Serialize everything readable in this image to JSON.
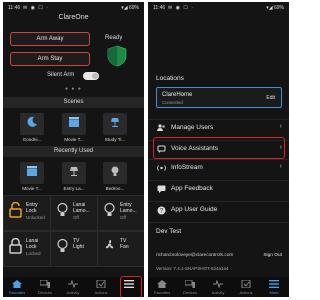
{
  "left": {
    "status": {
      "time": "11:46",
      "battery": "69%"
    },
    "title": "ClareOne",
    "arm_away": "Arm Away",
    "arm_stay": "Arm Stay",
    "ready": "Ready",
    "silent_arm": "Silent Arm",
    "scenes_header": "Scenes",
    "scenes": [
      "Goodni...",
      "Movie T...",
      "Study Ti..."
    ],
    "recent_header": "Recently Used",
    "recent": [
      "Movie T...",
      "Entry La...",
      "Bedroo..."
    ],
    "devices": [
      {
        "name1": "Entry",
        "name2": "Lock",
        "state": "Unlocked"
      },
      {
        "name1": "Lanai",
        "name2": "Lamo...",
        "state": "Off"
      },
      {
        "name1": "Entry",
        "name2": "Lamo...",
        "state": "Off"
      },
      {
        "name1": "Lanai",
        "name2": "Lock",
        "state": "Locked"
      },
      {
        "name1": "TV",
        "name2": "Light",
        "state": ""
      },
      {
        "name1": "TV",
        "name2": "Fan",
        "state": ""
      }
    ]
  },
  "right": {
    "status": {
      "time": "11:46",
      "battery": "69%"
    },
    "locations_header": "Locations",
    "location_name": "ClareHome",
    "location_status": "Connected",
    "edit": "Edit",
    "menu": [
      {
        "label": "Manage Users",
        "icon": "users-icon"
      },
      {
        "label": "Voice Assistants",
        "icon": "microphone-icon"
      },
      {
        "label": "InfoStream",
        "icon": "stream-icon"
      },
      {
        "label": "App Feedback",
        "icon": "feedback-icon"
      },
      {
        "label": "App User Guide",
        "icon": "help-icon"
      }
    ],
    "dev_test": "Dev Test",
    "email": "richard.soloveye@clarecontrols.com",
    "sign_out": "Sign Out",
    "version": "Version: 7.4.1-SNAPSHOT-524a1a4"
  },
  "tabs": [
    "Favorites",
    "Devices",
    "Activity",
    "Actions",
    "More"
  ],
  "colors": {
    "accent": "#4aa0e6",
    "arm_border": "#d0453b",
    "shield": "#1e8a4a",
    "highlight": "#e02020",
    "location_border": "#3d8fd8"
  }
}
